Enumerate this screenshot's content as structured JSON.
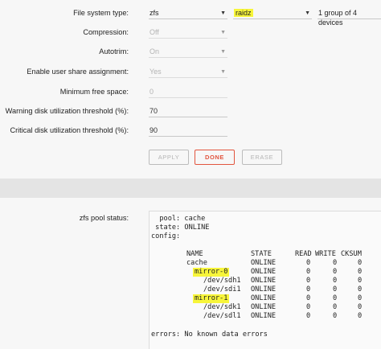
{
  "form": {
    "filesystem": {
      "label": "File system type:",
      "value": "zfs",
      "layout": "raidz",
      "groups": "1 group of 4 devices"
    },
    "compression": {
      "label": "Compression:",
      "value": "Off"
    },
    "autotrim": {
      "label": "Autotrim:",
      "value": "On"
    },
    "share": {
      "label": "Enable user share assignment:",
      "value": "Yes"
    },
    "minfree": {
      "label": "Minimum free space:",
      "value": "0"
    },
    "warning": {
      "label": "Warning disk utilization threshold (%):",
      "value": "70"
    },
    "critical": {
      "label": "Critical disk utilization threshold (%):",
      "value": "90"
    }
  },
  "buttons": {
    "apply": "APPLY",
    "done": "DONE",
    "erase": "ERASE"
  },
  "pool_status": {
    "label": "zfs pool status:",
    "pool_line": "  pool: cache",
    "state_line": " state: ONLINE",
    "config_line": "config:",
    "headers": [
      "NAME",
      "STATE",
      "READ",
      "WRITE",
      "CKSUM"
    ],
    "rows": [
      {
        "name": "cache",
        "state": "ONLINE",
        "read": "0",
        "write": "0",
        "cksum": "0"
      },
      {
        "name": "mirror-0",
        "state": "ONLINE",
        "read": "0",
        "write": "0",
        "cksum": "0"
      },
      {
        "name": "/dev/sdh1",
        "state": "ONLINE",
        "read": "0",
        "write": "0",
        "cksum": "0"
      },
      {
        "name": "/dev/sdi1",
        "state": "ONLINE",
        "read": "0",
        "write": "0",
        "cksum": "0"
      },
      {
        "name": "mirror-1",
        "state": "ONLINE",
        "read": "0",
        "write": "0",
        "cksum": "0"
      },
      {
        "name": "/dev/sdk1",
        "state": "ONLINE",
        "read": "0",
        "write": "0",
        "cksum": "0"
      },
      {
        "name": "/dev/sdl1",
        "state": "ONLINE",
        "read": "0",
        "write": "0",
        "cksum": "0"
      }
    ],
    "errors_line": "errors: No known data errors"
  },
  "colors": {
    "highlight": "#f7f53a",
    "done_accent": "#e2553f",
    "disabled_text": "#b3b3b3"
  },
  "icons": {
    "dropdown": "chevron-down-icon"
  }
}
